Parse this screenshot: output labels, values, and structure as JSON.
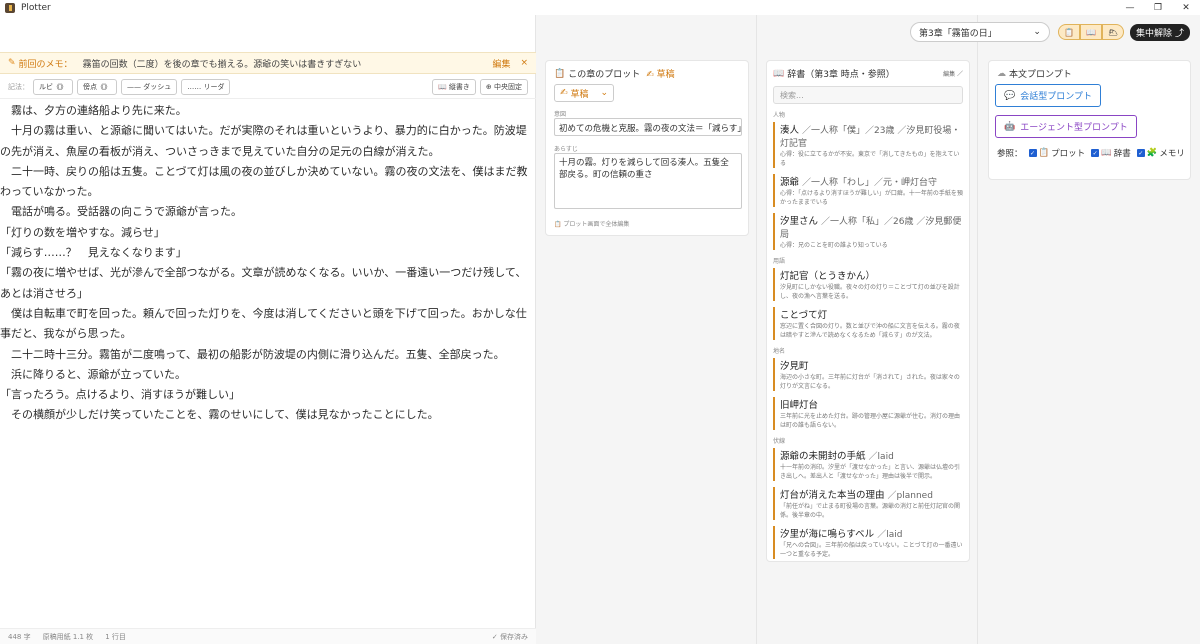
{
  "window": {
    "title": "Plotter",
    "controls": [
      "—",
      "❐",
      "✕"
    ]
  },
  "topbar": {
    "chapter_select": "第3章「霧笛の日」",
    "view_pills": [
      "📋",
      "📖",
      "🌥"
    ],
    "focus_release": "集中解除",
    "focus_icon": "⤴"
  },
  "memo": {
    "label": "前回のメモ：",
    "text": "霧笛の回数（二度）を後の章でも揃える。源爺の笑いは書きすぎない",
    "edit": "編集",
    "close": "×"
  },
  "toolbar": {
    "label": "記法：",
    "ruby": "ルビ《》",
    "emphasis": "傍点《》",
    "dash": "—— ダッシュ",
    "leader": "…… リーダ",
    "vertical": "📖 縦書き",
    "center": "⊕ 中央固定"
  },
  "editor": {
    "paragraphs": [
      "　霧は、夕方の連絡船より先に来た。",
      "　十月の霧は重い、と源爺に聞いてはいた。だが実際のそれは重いというより、暴力的に白かった。防波堤の先が消え、魚屋の看板が消え、ついさっきまで見えていた自分の足元の白線が消えた。",
      "　二十一時、戻りの船は五隻。ことづて灯は風の夜の並びしか決めていない。霧の夜の文法を、僕はまだ教わっていなかった。",
      "　電話が鳴る。受話器の向こうで源爺が言った。",
      "「灯りの数を増やすな。減らせ」",
      "「減らす……？　見えなくなります」",
      "「霧の夜に増やせば、光が滲んで全部つながる。文章が読めなくなる。いいか、一番遠い一つだけ残して、あとは消させろ」",
      "　僕は自転車で町を回った。頼んで回った灯りを、今度は消してくださいと頭を下げて回った。おかしな仕事だと、我ながら思った。",
      "　二十二時十三分。霧笛が二度鳴って、最初の船影が防波堤の内側に滑り込んだ。五隻、全部戻った。",
      "　浜に降りると、源爺が立っていた。",
      "「言ったろう。点けるより、消すほうが難しい」",
      "　その横顔が少しだけ笑っていたことを、霧のせいにして、僕は見なかったことにした。"
    ]
  },
  "status": {
    "chars": "448 字",
    "manuscript": "原稿用紙 1.1 枚",
    "line": "1 行目",
    "saved": "✓ 保存済み"
  },
  "plot": {
    "title": "この章のプロット",
    "draft_badge": "草稿",
    "status_select": "草稿",
    "intent_label": "意図",
    "intent_value": "初めての危機と克服。霧の夜の文法＝「減らす」で読",
    "summary_label": "あらすじ",
    "summary_value": "十月の霧。灯りを減らして回る湊人。五隻全部戻る。町の信頼の重さ",
    "footer_note": "プロット画面で全体編集"
  },
  "dictionary": {
    "title": "辞書（第3章 時点・参照）",
    "edit_label": "編集",
    "search_placeholder": "検索...",
    "categories": [
      {
        "name": "人物",
        "entries": [
          {
            "name": "湊人",
            "sub": "／一人称「僕」／23歳 ／汐見町役場・灯記官",
            "desc": "心得：役に立てるかが不安。東京で「消してきたもの」を抱えている"
          },
          {
            "name": "源爺",
            "sub": "／一人称「わし」／元・岬灯台守",
            "desc": "心得：「点けるより消すほうが難しい」が口癖。十一年前の手紙を預かったままでいる"
          },
          {
            "name": "汐里さん",
            "sub": "／一人称「私」／26歳 ／汐見郵便局",
            "desc": "心得：兄のことを町の誰より知っている"
          }
        ]
      },
      {
        "name": "用語",
        "entries": [
          {
            "name": "灯記官（とうきかん）",
            "sub": "",
            "desc": "汐見町にしかない役職。夜々の灯の灯り＝ことづて灯の並びを設計し、夜の漁へ言葉を送る。"
          },
          {
            "name": "ことづて灯",
            "sub": "",
            "desc": "窓辺に置く合図の灯り。数と並びで沖の船に文言を伝える。霧の夜は暗やすと滲んで読めなくなるため「減らす」のが文法。"
          }
        ]
      },
      {
        "name": "地名",
        "entries": [
          {
            "name": "汐見町",
            "sub": "",
            "desc": "海辺の小さな町。三年前に灯台が「消されて」された。夜は家々の灯りが文言になる。"
          },
          {
            "name": "旧岬灯台",
            "sub": "",
            "desc": "三年前に光を止めた灯台。跡の管理小屋に源爺が住む。消灯の理由は町の誰も語らない。"
          }
        ]
      },
      {
        "name": "伏線",
        "entries": [
          {
            "name": "源爺の未開封の手紙",
            "sub": "／laid",
            "desc": "十一年前の消印。汐里が「渡せなかった」と言い、源爺は仏壇の引き出しへ。差出人と「渡せなかった」理由は後半で開示。"
          },
          {
            "name": "灯台が消えた本当の理由",
            "sub": "／planned",
            "desc": "「前任がね」で止まる町役場の言葉。源爺の消灯と前任灯記官の関係。後半章の中。"
          },
          {
            "name": "汐里が海に鳴らすベル",
            "sub": "／laid",
            "desc": "「兄への合図」。三年前の船は戻っていない。ことづて灯の一番遠い一つと重なる予定。"
          }
        ]
      }
    ]
  },
  "prompts": {
    "title": "本文プロンプト",
    "chat_button": "会話型プロンプト",
    "agent_button": "エージェント型プロンプト",
    "ref_label": "参照：",
    "ref_plot": "プロット",
    "ref_dict": "辞書",
    "ref_memo": "メモリ",
    "colors": {
      "chat": "#2f7fd6",
      "agent": "#8a45c4"
    }
  }
}
